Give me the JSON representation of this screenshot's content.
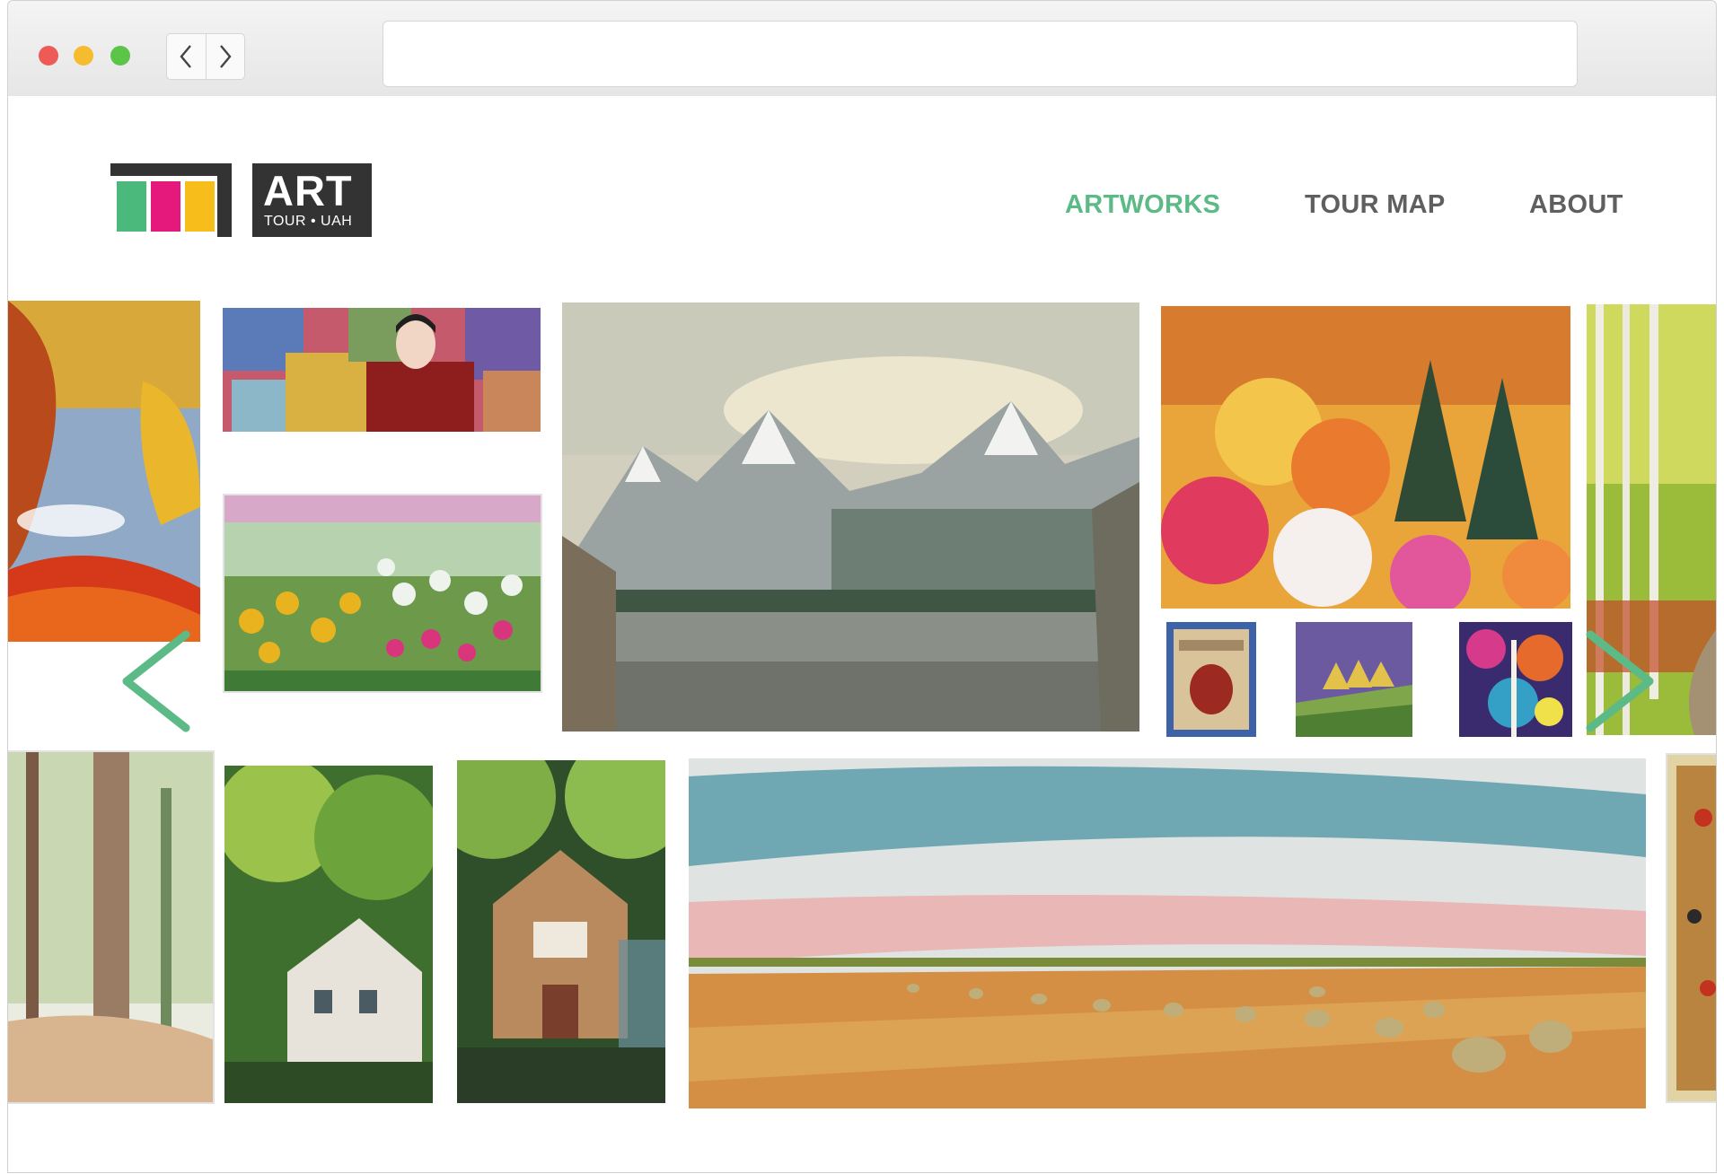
{
  "browser": {
    "controls": [
      "close",
      "minimize",
      "zoom"
    ],
    "url": ""
  },
  "colors": {
    "accent_green": "#5cba87",
    "nav_gray": "#5f5f5f",
    "logo_dark": "#333333",
    "logo_green": "#4cb97c",
    "logo_pink": "#e4197b",
    "logo_yellow": "#f7bd1a",
    "dot_red": "#ee5b56",
    "dot_yellow": "#f4bc2e",
    "dot_green": "#5cc447"
  },
  "logo": {
    "title": "ART",
    "subtitle": "TOUR • UAH"
  },
  "nav": {
    "items": [
      {
        "label": "ARTWORKS",
        "active": true
      },
      {
        "label": "TOUR MAP",
        "active": false
      },
      {
        "label": "ABOUT",
        "active": false
      }
    ]
  },
  "gallery": {
    "artworks": [
      {
        "subject": "autumn tree painting"
      },
      {
        "subject": "portrait with patterned background"
      },
      {
        "subject": "tulip field"
      },
      {
        "subject": "mountain lake"
      },
      {
        "subject": "autumn forest"
      },
      {
        "subject": "illustrated heart"
      },
      {
        "subject": "tipis on hills"
      },
      {
        "subject": "abstract colorful trees"
      },
      {
        "subject": "birch forest path"
      },
      {
        "subject": "forest tree watercolor"
      },
      {
        "subject": "house among trees"
      },
      {
        "subject": "cottage under trees"
      },
      {
        "subject": "prairie hay bales"
      },
      {
        "subject": "abstract framed painting"
      }
    ],
    "prev_icon": "chevron-left-icon",
    "next_icon": "chevron-right-icon"
  }
}
